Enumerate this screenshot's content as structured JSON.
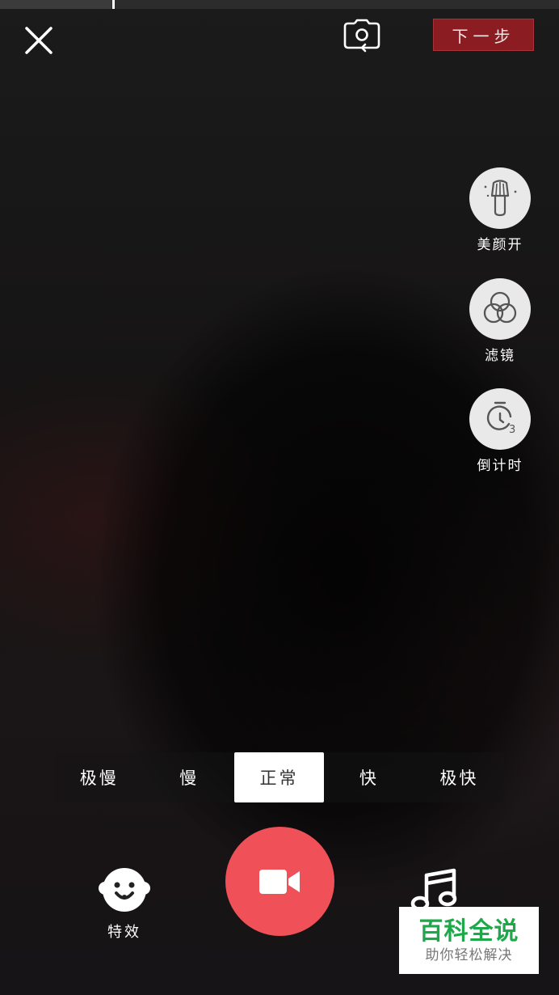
{
  "record_progress": 0.2,
  "top_bar": {
    "close_icon": "close-icon",
    "flip_icon": "camera-flip-icon",
    "next_label": "下一步"
  },
  "side_tools": [
    {
      "icon": "beauty-brush-icon",
      "label": "美颜开"
    },
    {
      "icon": "filter-circles-icon",
      "label": "滤镜"
    },
    {
      "icon": "timer-3-icon",
      "label": "倒计时"
    }
  ],
  "speed": {
    "options": [
      "极慢",
      "慢",
      "正常",
      "快",
      "极快"
    ],
    "selected": "正常"
  },
  "bottom": {
    "effects_label": "特效",
    "effects_icon": "face-icon",
    "record_icon": "video-camera-icon",
    "music_icon": "music-note-icon"
  },
  "watermark": {
    "title": "百科全说",
    "subtitle": "助你轻松解决"
  },
  "colors": {
    "record": "#f05058",
    "next_button": "#8a1c22",
    "watermark_green": "#1fa84a"
  }
}
